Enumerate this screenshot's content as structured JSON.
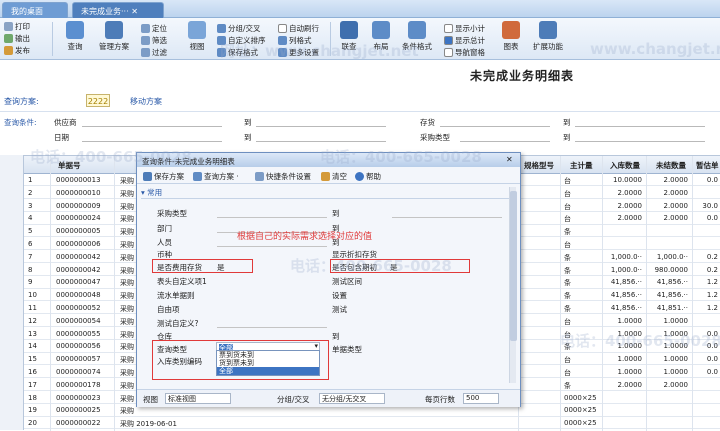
{
  "tabs": [
    "我的桌面",
    "未完成业务···"
  ],
  "ribbon": {
    "small_left": [
      "打印",
      "输出",
      "发布"
    ],
    "big": [
      "查询",
      "管理方案"
    ],
    "mid1": [
      "定位",
      "筛选",
      "过滤"
    ],
    "big2": [
      "视图"
    ],
    "mid2": [
      "分组/交叉",
      "自定义排序",
      "保存格式"
    ],
    "mid3": [
      "自动刷行",
      "列格式",
      "更多设置"
    ],
    "big3": [
      "联查",
      "布局",
      "条件格式",
      "图表",
      "扩展功能"
    ],
    "checks": [
      "显示小计",
      "显示总计",
      "导航窗格"
    ]
  },
  "report_title": "未完成业务明细表",
  "scheme": {
    "label": "查询方案:",
    "value": "2222",
    "move": "移动方案"
  },
  "query": {
    "label": "查询条件:",
    "supplier": "供应商",
    "to1": "到",
    "inventory": "存货",
    "to2": "到",
    "date": "日期",
    "to3": "到",
    "purchase_type": "采购类型",
    "to4": "到"
  },
  "grid": {
    "headers": [
      "单据号",
      "",
      "规格型号",
      "主计量",
      "入库数量",
      "未结数量",
      "暂估单"
    ],
    "rows": [
      [
        "1",
        "0000000013",
        "采购",
        "台",
        "10.0000",
        "2.0000",
        "0.0"
      ],
      [
        "2",
        "0000000010",
        "采购",
        "台",
        "2.0000",
        "2.0000",
        ""
      ],
      [
        "3",
        "0000000009",
        "采购",
        "台",
        "2.0000",
        "2.0000",
        "30.0"
      ],
      [
        "4",
        "0000000024",
        "采购",
        "台",
        "2.0000",
        "2.0000",
        "0.0"
      ],
      [
        "5",
        "0000000005",
        "采购",
        "条",
        "",
        "",
        ""
      ],
      [
        "6",
        "0000000006",
        "采购",
        "台",
        "",
        "",
        ""
      ],
      [
        "7",
        "0000000042",
        "采购",
        "条",
        "1,000.0··",
        "1,000.0··",
        "0.2"
      ],
      [
        "8",
        "0000000042",
        "采购",
        "条",
        "1,000.0··",
        "980.0000",
        "0.2"
      ],
      [
        "9",
        "0000000047",
        "采购",
        "条",
        "41,856.··",
        "41,856.··",
        "1.2"
      ],
      [
        "10",
        "0000000048",
        "采购",
        "条",
        "41,856.··",
        "41,856.··",
        "1.2"
      ],
      [
        "11",
        "0000000052",
        "采购",
        "条",
        "41,856.··",
        "41,851.··",
        "1.2"
      ],
      [
        "12",
        "0000000054",
        "采购",
        "台",
        "1.0000",
        "1.0000",
        ""
      ],
      [
        "13",
        "0000000055",
        "采购",
        "台",
        "1.0000",
        "1.0000",
        "0.0"
      ],
      [
        "14",
        "0000000056",
        "采购",
        "条",
        "1.0000",
        "1.0000",
        "0.0"
      ],
      [
        "15",
        "0000000057",
        "采购",
        "台",
        "1.0000",
        "1.0000",
        "0.0"
      ],
      [
        "16",
        "0000000074",
        "采购",
        "台",
        "1.0000",
        "1.0000",
        "0.0"
      ],
      [
        "17",
        "0000000178",
        "采购",
        "条",
        "2.0000",
        "2.0000",
        ""
      ],
      [
        "18",
        "0000000023",
        "采购",
        "0000×25",
        "",
        "",
        ""
      ],
      [
        "19",
        "0000000025",
        "采购",
        "0000×25",
        "",
        "",
        ""
      ],
      [
        "20",
        "0000000022",
        "采购 2019-06-01",
        "0000×25",
        "",
        "",
        ""
      ]
    ]
  },
  "dialog": {
    "title": "查询条件-未完成业务明细表",
    "toolbar": [
      "保存方案",
      "查询方案 ·",
      "快捷条件设置",
      "清空",
      "帮助"
    ],
    "section": "常用",
    "hint": "根据自己的实际需求选择对应的值",
    "fields_left": [
      "采购类型",
      "部门",
      "人员",
      "币种",
      "是否费用存货",
      "表头自定义项1",
      "流水单据则",
      "自由项",
      "测试自定义?",
      "仓库",
      "查询类型",
      "入库类别编码"
    ],
    "fields_right": [
      "到",
      "到",
      "到",
      "到",
      "是否包含期初",
      "到",
      "设置",
      "测试",
      "到",
      "单据类型"
    ],
    "labels_extra": {
      "display_convert": "显示折扣存货",
      "test_range": "测试区间"
    },
    "expense_value": "是",
    "include_value": "是",
    "query_type_value": "全部",
    "dropdown": [
      "票到货未到",
      "货到票未到",
      "全部"
    ],
    "view_label": "视图",
    "view_value": "标准视图",
    "group_label": "分组/交叉",
    "group_value": "无分组/无交叉",
    "rows_label": "每页行数",
    "rows_value": "500"
  },
  "watermark": [
    "电话：400-665-0028",
    "www.changjet.net",
    "网址：www.changjet.net"
  ]
}
